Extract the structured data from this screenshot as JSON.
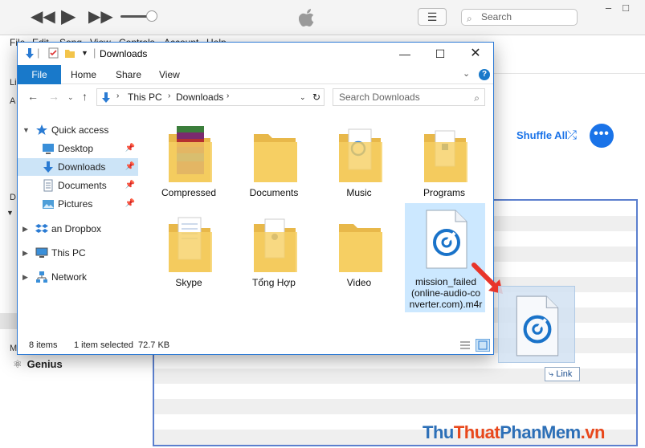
{
  "itunes": {
    "search_placeholder": "Search",
    "menu": [
      "File",
      "Edit",
      "Song",
      "View",
      "Controls",
      "Account",
      "Help"
    ],
    "sidebar_fragments": [
      "Li",
      "Li",
      "A",
      "A",
      "A",
      "D",
      "M"
    ],
    "shuffle_label": "Shuffle All",
    "more_label": "•••",
    "genius_label": "Genius",
    "accent_color": "#1a73e8"
  },
  "explorer": {
    "title": "Downloads",
    "ribbon_tabs": [
      "File",
      "Home",
      "Share",
      "View"
    ],
    "breadcrumb": [
      "This PC",
      "Downloads"
    ],
    "search_placeholder": "Search Downloads",
    "nav_pane": [
      {
        "label": "Quick access",
        "icon": "star-icon",
        "pinned": false
      },
      {
        "label": "Desktop",
        "icon": "desktop-icon",
        "pinned": true
      },
      {
        "label": "Downloads",
        "icon": "download-icon",
        "pinned": true,
        "selected": true
      },
      {
        "label": "Documents",
        "icon": "documents-icon",
        "pinned": true
      },
      {
        "label": "Pictures",
        "icon": "pictures-icon",
        "pinned": true
      },
      {
        "label": "an Dropbox",
        "icon": "dropbox-icon",
        "pinned": false
      },
      {
        "label": "This PC",
        "icon": "pc-icon",
        "pinned": false
      },
      {
        "label": "Network",
        "icon": "network-icon",
        "pinned": false
      }
    ],
    "items": [
      {
        "label": "Compressed",
        "icon": "winrar-folder-icon"
      },
      {
        "label": "Documents",
        "icon": "folder-icon"
      },
      {
        "label": "Music",
        "icon": "music-folder-icon"
      },
      {
        "label": "Programs",
        "icon": "programs-folder-icon"
      },
      {
        "label": "Skype",
        "icon": "skype-folder-icon"
      },
      {
        "label": "Tổng Hợp",
        "icon": "folder-icon"
      },
      {
        "label": "Video",
        "icon": "folder-icon"
      },
      {
        "label_lines": [
          "mission_failed",
          "(online-audio-co",
          "nverter.com).m4r"
        ],
        "icon": "audio-file-icon",
        "selected": true
      }
    ],
    "status": {
      "count": "8 items",
      "selection": "1 item selected",
      "size": "72.7 KB"
    }
  },
  "drag": {
    "link_label": "Link"
  },
  "watermark": {
    "p1": "Thu",
    "p2": "Thuat",
    "p3": "PhanMem",
    "p4": ".vn"
  }
}
